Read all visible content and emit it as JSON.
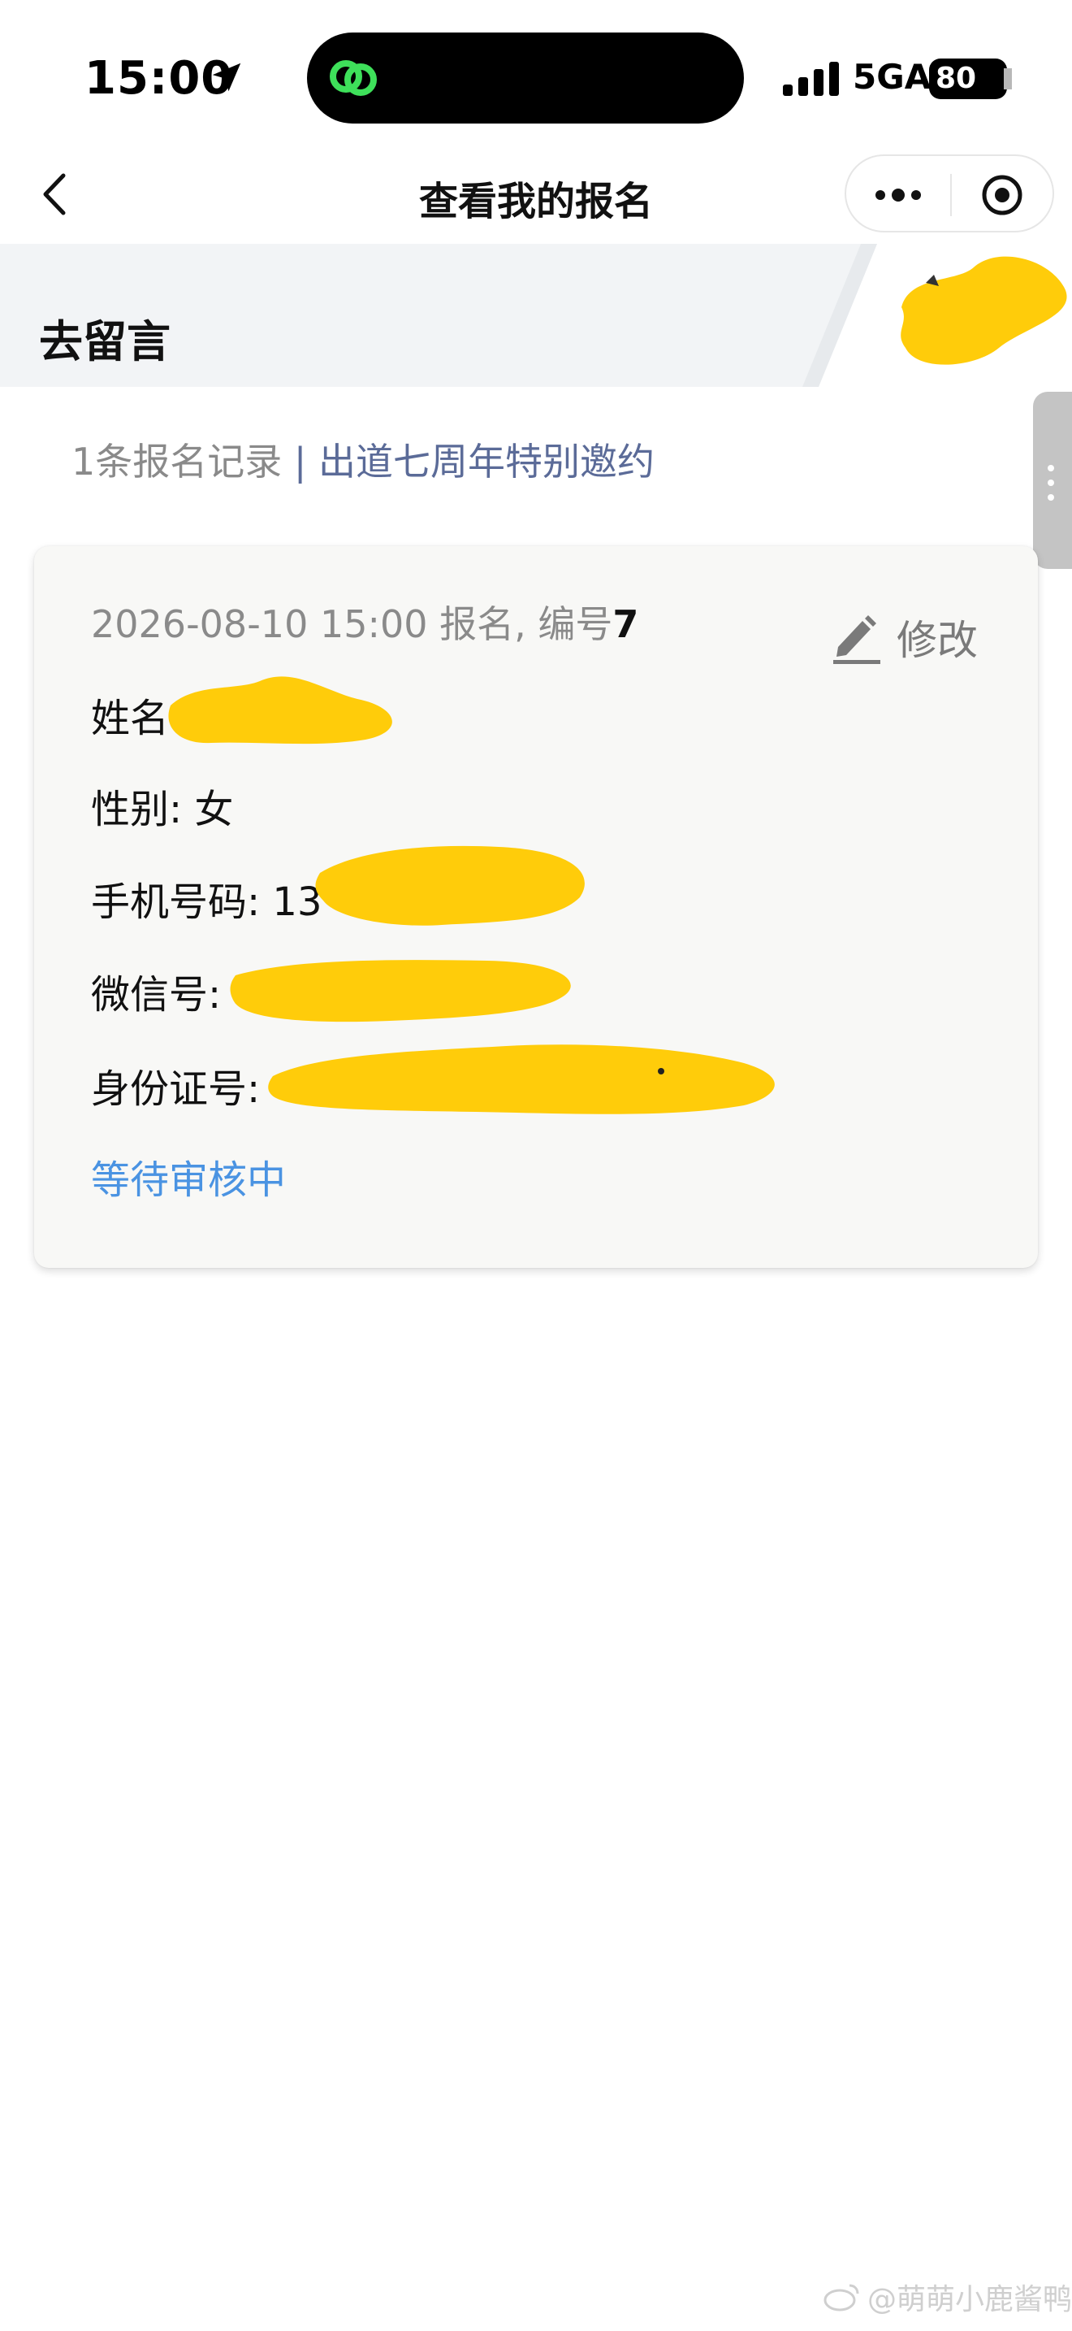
{
  "status_bar": {
    "time": "15:00",
    "network": "5GA",
    "battery": "80"
  },
  "nav": {
    "title": "查看我的报名"
  },
  "banner": {
    "title": "去留言"
  },
  "summary": {
    "count_text": "1条报名记录",
    "separator": "|",
    "event_text": "出道七周年特别邀约"
  },
  "record": {
    "date_text": "2026-08-10 15:00 报名, 编号",
    "number": "7",
    "edit_label": "修改",
    "fields": {
      "name": "姓名",
      "gender": "性别: 女",
      "phone": "手机号码: 13",
      "wechat": "微信号: ",
      "id_number": "身份证号: "
    },
    "status": "等待审核中"
  },
  "watermark": {
    "text": "@萌萌小鹿酱鸭"
  },
  "colors": {
    "link_blue": "#4a93e2",
    "event_blue": "#5b6b98",
    "redaction_yellow": "#ffcc0a",
    "banner_bg": "#f2f4f6"
  }
}
